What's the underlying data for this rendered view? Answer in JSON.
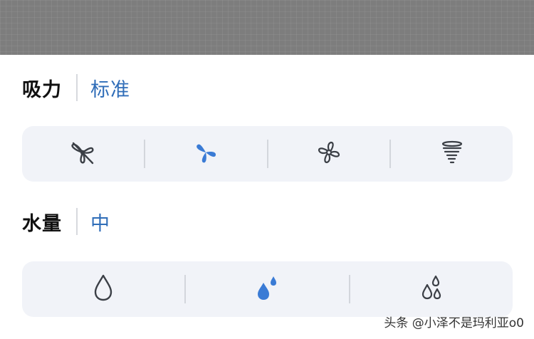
{
  "suction": {
    "label": "吸力",
    "value": "标准",
    "options": [
      {
        "icon": "fan-quiet-icon",
        "selected": false
      },
      {
        "icon": "fan-standard-icon",
        "selected": true
      },
      {
        "icon": "fan-strong-icon",
        "selected": false
      },
      {
        "icon": "tornado-max-icon",
        "selected": false
      }
    ]
  },
  "water": {
    "label": "水量",
    "value": "中",
    "options": [
      {
        "icon": "water-low-icon",
        "selected": false
      },
      {
        "icon": "water-medium-icon",
        "selected": true
      },
      {
        "icon": "water-high-icon",
        "selected": false
      }
    ]
  },
  "watermark": "头条 @小泽不是玛利亚o0",
  "colors": {
    "accent": "#3a7bd5",
    "value_text": "#2f6db8",
    "icon_inactive": "#3b3f46",
    "option_bg": "#f1f3f8",
    "backdrop": "#7d7d7d"
  }
}
